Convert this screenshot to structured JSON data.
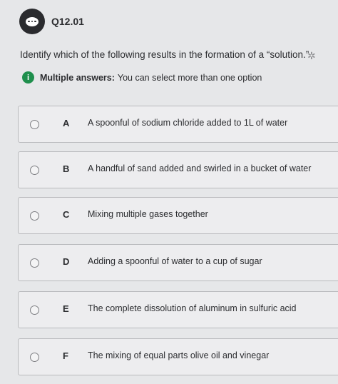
{
  "question_id": "Q12.01",
  "prompt": "Identify which of the following results in the formation of a “solution.”",
  "hint": {
    "bold": "Multiple answers:",
    "text": "You can select more than one option"
  },
  "options": [
    {
      "letter": "A",
      "text": "A spoonful of sodium chloride added to 1L of water"
    },
    {
      "letter": "B",
      "text": "A handful of sand added and swirled in a bucket of water"
    },
    {
      "letter": "C",
      "text": "Mixing multiple gases together"
    },
    {
      "letter": "D",
      "text": "Adding a spoonful of water to a cup of sugar"
    },
    {
      "letter": "E",
      "text": "The complete dissolution of aluminum in sulfuric acid"
    },
    {
      "letter": "F",
      "text": "The mixing of equal parts olive oil and vinegar"
    }
  ],
  "colors": {
    "background": "#e6e7e9",
    "info_icon": "#1f8f4d",
    "question_icon": "#2a2b2e"
  }
}
